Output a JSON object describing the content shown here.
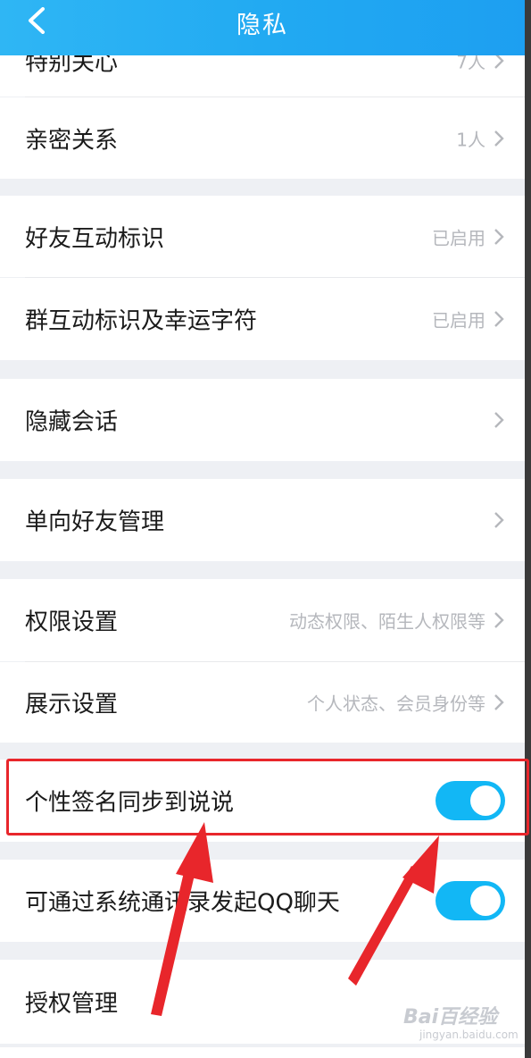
{
  "header": {
    "title": "隐私",
    "back_icon": "back-chevron-icon"
  },
  "rows": [
    {
      "label": "特别关心",
      "value": "7人"
    },
    {
      "label": "亲密关系",
      "value": "1人"
    },
    {
      "label": "好友互动标识",
      "value": "已启用"
    },
    {
      "label": "群互动标识及幸运字符",
      "value": "已启用"
    },
    {
      "label": "隐藏会话",
      "value": ""
    },
    {
      "label": "单向好友管理",
      "value": ""
    },
    {
      "label": "权限设置",
      "value": "动态权限、陌生人权限等"
    },
    {
      "label": "展示设置",
      "value": "个人状态、会员身份等"
    },
    {
      "label": "个性签名同步到说说",
      "toggle": true
    },
    {
      "label": "可通过系统通讯录发起QQ聊天",
      "toggle": true
    },
    {
      "label": "授权管理",
      "value": ""
    }
  ],
  "watermark": {
    "logo": "Bai百经验",
    "sub": "jingyan.baidu.com"
  },
  "colors": {
    "nav_bar": "#21a9f2",
    "toggle_on": "#12b7f5",
    "highlight": "#e8262b",
    "arrow": "#e8262b"
  }
}
